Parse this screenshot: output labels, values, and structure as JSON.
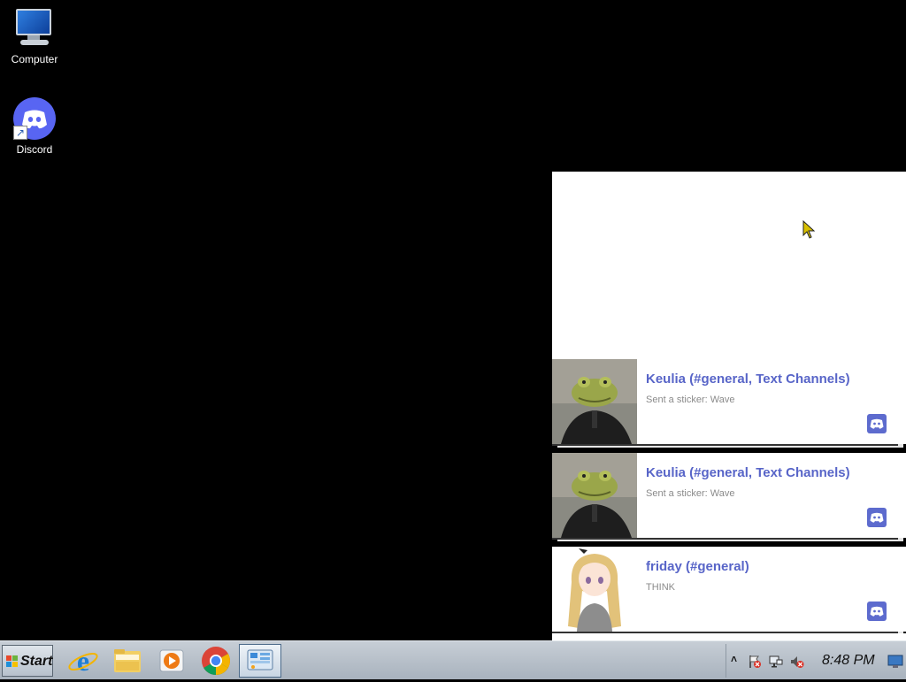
{
  "desktop": {
    "icons": [
      {
        "label": "Computer",
        "icon": "computer-icon"
      },
      {
        "label": "Discord",
        "icon": "discord-icon"
      }
    ]
  },
  "notifications": [
    {
      "title": "Keulia (#general, Text Channels)",
      "body": "Sent a sticker: Wave",
      "avatar": "frog-avatar-icon"
    },
    {
      "title": "Keulia (#general, Text Channels)",
      "body": "Sent a sticker: Wave",
      "avatar": "frog-avatar-icon"
    },
    {
      "title": "friday (#general)",
      "body": "THINK",
      "avatar": "anime-girl-avatar-icon"
    }
  ],
  "taskbar": {
    "start_label": "Start",
    "pinned": [
      "internet-explorer-icon",
      "file-explorer-icon",
      "media-player-icon",
      "chrome-icon",
      "control-panel-icon"
    ],
    "clock": "8:48 PM"
  },
  "colors": {
    "discord_blurple": "#5865f2",
    "notification_title": "#5865c8",
    "desktop_bg": "#000000"
  }
}
